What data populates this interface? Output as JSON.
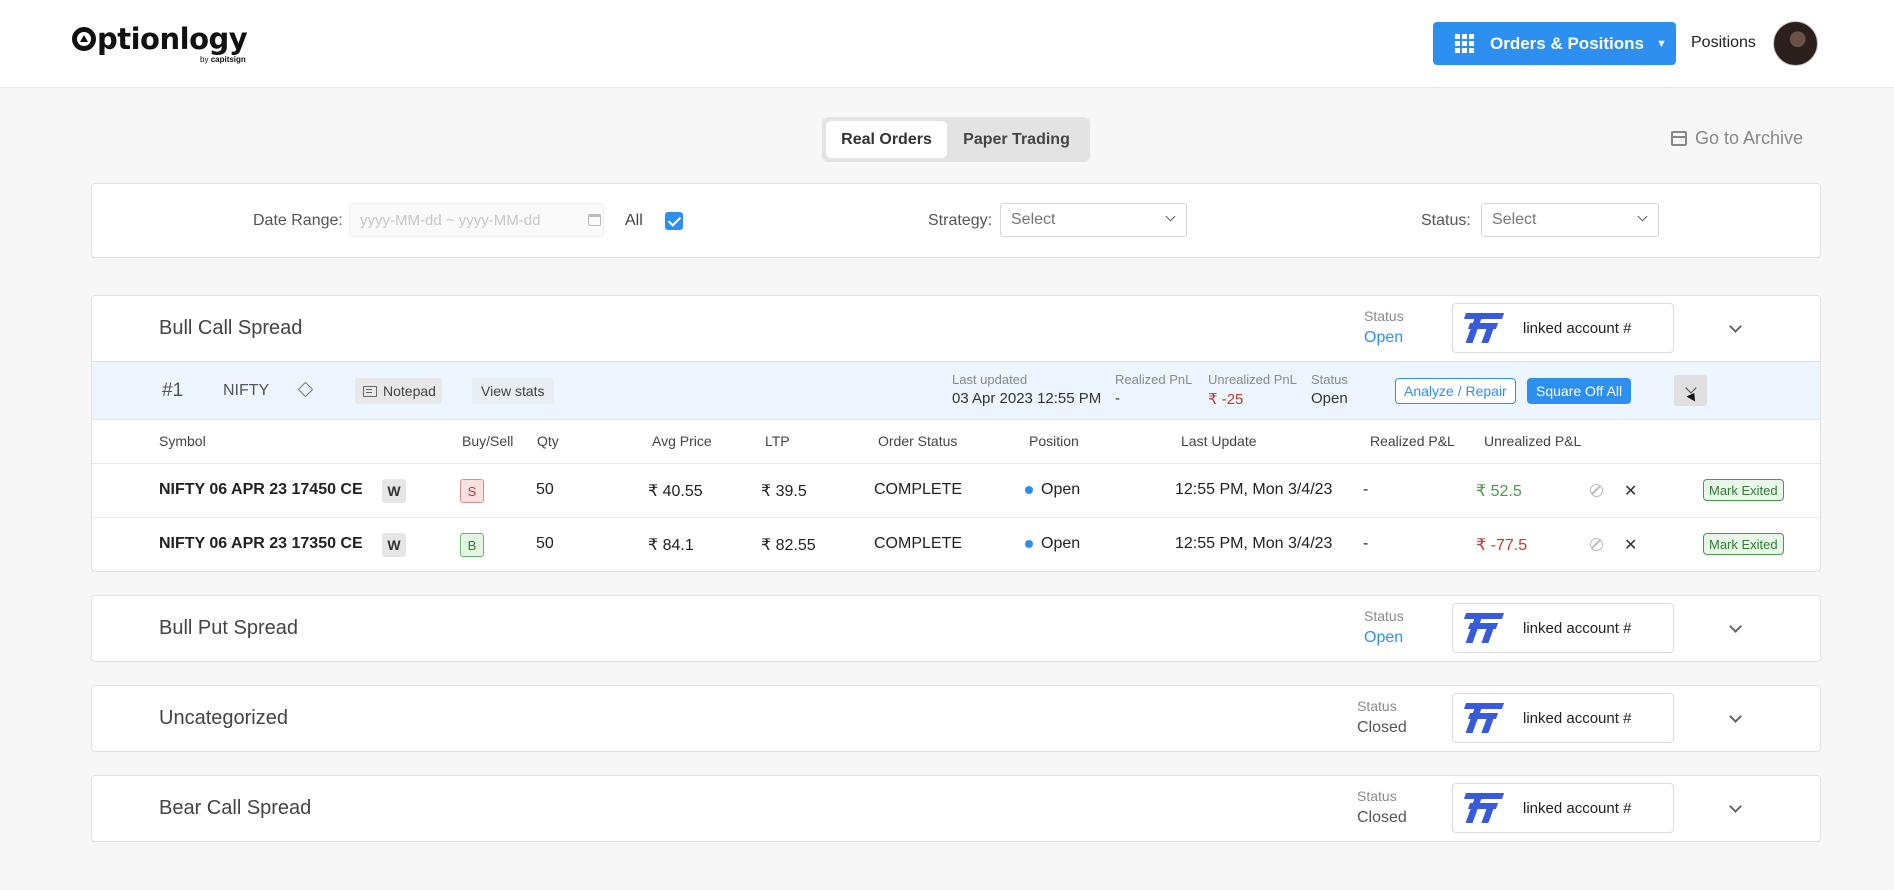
{
  "header": {
    "logo_text": "ptionlogy",
    "logo_sub_by": "by",
    "logo_sub_brand": "capitsign",
    "orders_button": "Orders & Positions",
    "positions_link": "Positions"
  },
  "toggle": {
    "real": "Real Orders",
    "paper": "Paper Trading"
  },
  "archive": "Go to Archive",
  "filters": {
    "date_range_label": "Date Range:",
    "date_placeholder": "yyyy-MM-dd ~ yyyy-MM-dd",
    "all_label": "All",
    "all_checked": true,
    "strategy_label": "Strategy:",
    "strategy_value": "Select",
    "status_label": "Status:",
    "status_value": "Select"
  },
  "strategies": [
    {
      "title": "Bull Call Spread",
      "status_label": "Status",
      "status": "Open",
      "account": "linked account #"
    },
    {
      "title": "Bull Put Spread",
      "status_label": "Status",
      "status": "Open",
      "account": "linked account #"
    },
    {
      "title": "Uncategorized",
      "status_label": "Status",
      "status": "Closed",
      "account": "linked account #"
    },
    {
      "title": "Bear Call Spread",
      "status_label": "Status",
      "status": "Closed",
      "account": "linked account #"
    }
  ],
  "order": {
    "num": "#1",
    "symbol": "NIFTY",
    "notepad": "Notepad",
    "view_stats": "View stats",
    "last_updated_label": "Last updated",
    "last_updated": "03 Apr 2023 12:55 PM",
    "realized_label": "Realized PnL",
    "realized": "-",
    "unrealized_label": "Unrealized PnL",
    "unrealized": "₹ -25",
    "status_label": "Status",
    "status": "Open",
    "analyze": "Analyze / Repair",
    "square_off": "Square Off All"
  },
  "table": {
    "headers": [
      "Symbol",
      "Buy/Sell",
      "Qty",
      "Avg Price",
      "LTP",
      "Order Status",
      "Position",
      "Last Update",
      "Realized P&L",
      "Unrealized P&L"
    ],
    "rows": [
      {
        "symbol": "NIFTY 06 APR 23 17450 CE",
        "w": "W",
        "side": "S",
        "qty": "50",
        "avg": "₹ 40.55",
        "ltp": "₹ 39.5",
        "order_status": "COMPLETE",
        "position": "Open",
        "last_update": "12:55 PM, Mon 3/4/23",
        "realized": "-",
        "unrealized": "₹ 52.5",
        "mark": "Mark Exited"
      },
      {
        "symbol": "NIFTY 06 APR 23 17350 CE",
        "w": "W",
        "side": "B",
        "qty": "50",
        "avg": "₹ 84.1",
        "ltp": "₹ 82.55",
        "order_status": "COMPLETE",
        "position": "Open",
        "last_update": "12:55 PM, Mon 3/4/23",
        "realized": "-",
        "unrealized": "₹ -77.5",
        "mark": "Mark Exited"
      }
    ]
  },
  "colors": {
    "accent": "#2d8ff0",
    "positive": "#4a9a4a",
    "negative": "#c0392b",
    "brand_logo": "#3a5bd9"
  }
}
